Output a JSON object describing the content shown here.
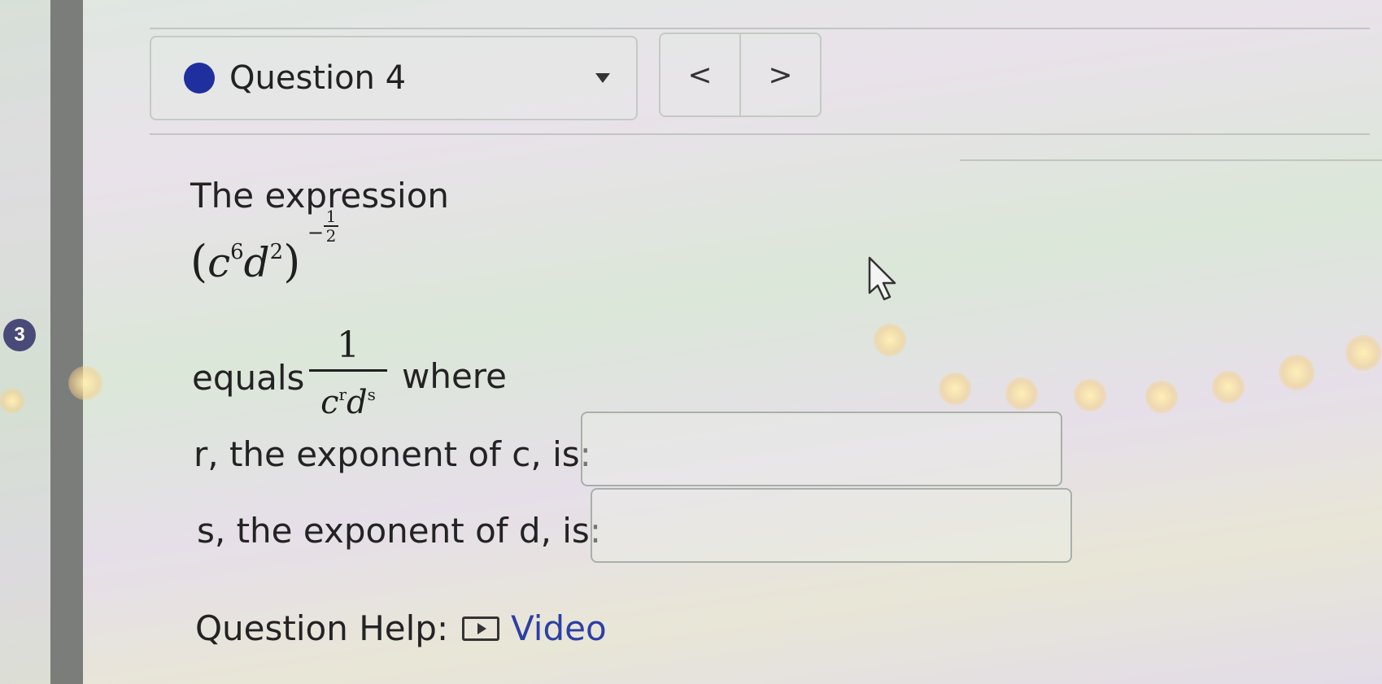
{
  "step_badge": "3",
  "question_nav": {
    "title": "Question 4",
    "prev_label": "<",
    "next_label": ">"
  },
  "problem": {
    "intro": "The expression",
    "expr_base_c": "c",
    "expr_exp_c": "6",
    "expr_base_d": "d",
    "expr_exp_d": "2",
    "expr_outer_exp_sign": "−",
    "expr_outer_exp_num": "1",
    "expr_outer_exp_den": "2",
    "equals_word": "equals",
    "frac_numerator": "1",
    "frac_den_c": "c",
    "frac_den_r": "r",
    "frac_den_d": "d",
    "frac_den_s": "s",
    "where_word": "where"
  },
  "answers": [
    {
      "label": "r, the exponent of c, is:",
      "value": ""
    },
    {
      "label": "s, the exponent of d, is:",
      "value": ""
    }
  ],
  "help": {
    "label": "Question Help:",
    "video_label": "Video"
  },
  "colors": {
    "status_dot": "#1f2f9e",
    "link": "#2d3fa3",
    "badge": "#4a4a78"
  }
}
